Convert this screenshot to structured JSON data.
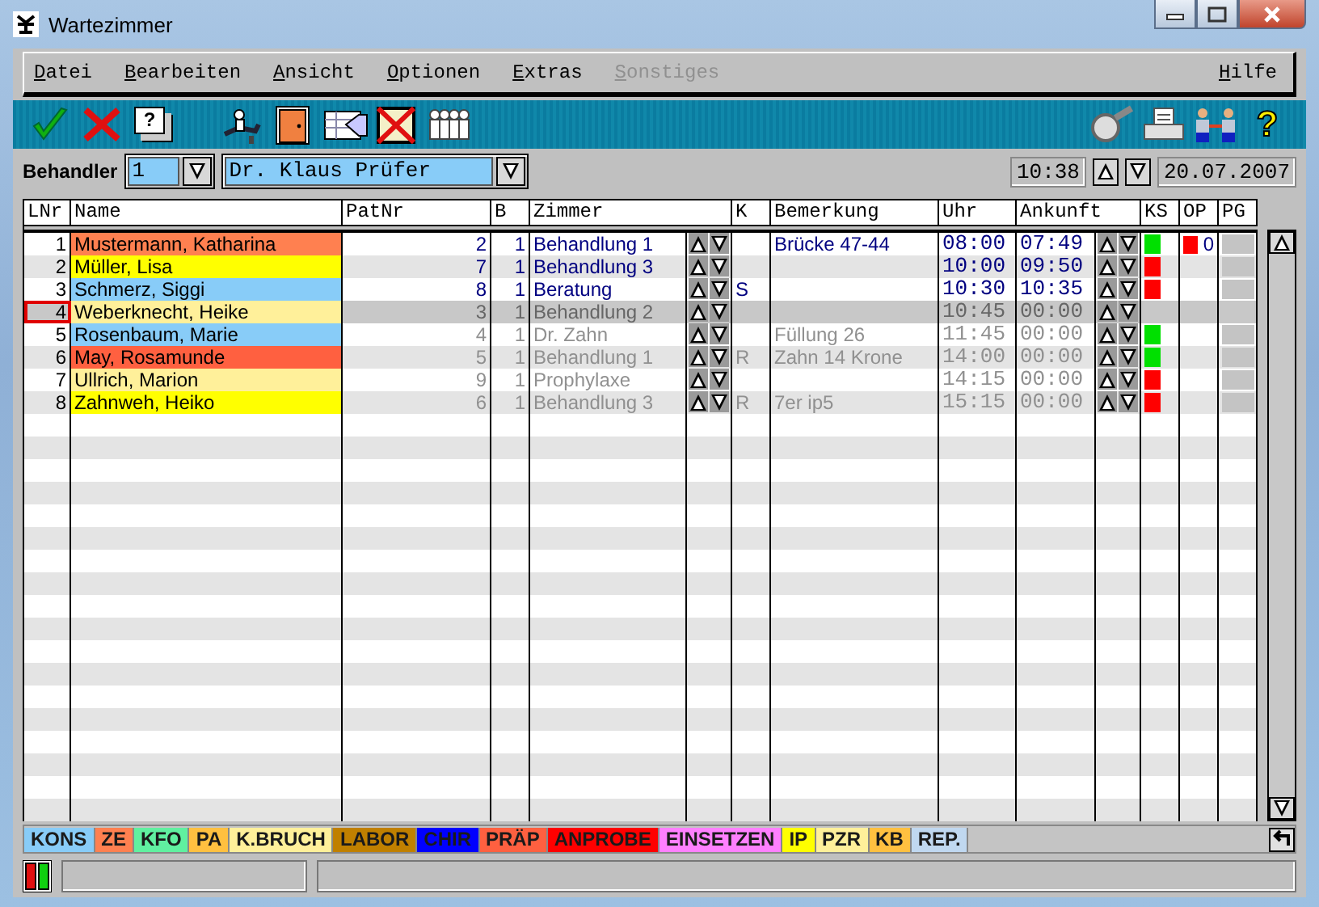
{
  "window": {
    "title": "Wartezimmer"
  },
  "menu": [
    {
      "label": "Datei",
      "disabled": false
    },
    {
      "label": "Bearbeiten",
      "disabled": false
    },
    {
      "label": "Ansicht",
      "disabled": false
    },
    {
      "label": "Optionen",
      "disabled": false
    },
    {
      "label": "Extras",
      "disabled": false
    },
    {
      "label": "Sonstiges",
      "disabled": true
    },
    {
      "label": "Hilfe",
      "disabled": false
    }
  ],
  "toolbar": {
    "left": [
      {
        "kind": "check"
      },
      {
        "kind": "cancel"
      },
      {
        "kind": "help-pages",
        "glyph": "?"
      },
      {
        "kind": "dentist"
      },
      {
        "kind": "door"
      },
      {
        "kind": "card"
      },
      {
        "kind": "crossed"
      },
      {
        "kind": "group"
      }
    ],
    "right": [
      {
        "kind": "magnifier"
      },
      {
        "kind": "printer"
      },
      {
        "kind": "meeting"
      },
      {
        "kind": "help",
        "glyph": "?"
      }
    ]
  },
  "behandler": {
    "label": "Behandler",
    "number": "1",
    "name": "Dr. Klaus Prüfer"
  },
  "clock": {
    "time": "10:38",
    "date": "20.07.2007"
  },
  "table": {
    "columns": [
      "LNr",
      "Name",
      "PatNr",
      "B",
      "Zimmer",
      "K",
      "Bemerkung",
      "Uhr",
      "Ankunft",
      "KS",
      "OP",
      "PG"
    ],
    "rows": [
      {
        "lnr": "1",
        "name": "Mustermann, Katharina",
        "color": "#ff8050",
        "patnr": "2",
        "b": "1",
        "zimmer": "Behandlung 1",
        "bemerkung": "Brücke 47-44",
        "uhr": "08:00",
        "ankunft": "07:49",
        "arrived": true,
        "selected": false,
        "ks": {
          "color": "#00e000"
        },
        "op": {
          "color": "#ff0000",
          "text": "0"
        }
      },
      {
        "lnr": "2",
        "name": "Müller, Lisa",
        "color": "#ffff00",
        "patnr": "7",
        "b": "1",
        "zimmer": "Behandlung 3",
        "uhr": "10:00",
        "ankunft": "09:50",
        "arrived": true,
        "selected": false,
        "ks": {
          "color": "#ff0000"
        }
      },
      {
        "lnr": "3",
        "name": "Schmerz, Siggi",
        "color": "#88ccf8",
        "patnr": "8",
        "b": "1",
        "zimmer": "Beratung",
        "k": "S",
        "uhr": "10:30",
        "ankunft": "10:35",
        "arrived": true,
        "selected": false,
        "ks": {
          "color": "#ff0000"
        }
      },
      {
        "lnr": "4",
        "name": "Weberknecht, Heike",
        "color": "#fff09a",
        "patnr": "3",
        "b": "1",
        "zimmer": "Behandlung 2",
        "uhr": "10:45",
        "ankunft": "00:00",
        "arrived": false,
        "selected": true
      },
      {
        "lnr": "5",
        "name": "Rosenbaum, Marie",
        "color": "#88ccf8",
        "patnr": "4",
        "b": "1",
        "zimmer": "Dr. Zahn",
        "bemerkung": "Füllung 26",
        "uhr": "11:45",
        "ankunft": "00:00",
        "arrived": false,
        "selected": false,
        "ks": {
          "color": "#00e000"
        }
      },
      {
        "lnr": "6",
        "name": "May, Rosamunde",
        "color": "#ff6040",
        "patnr": "5",
        "b": "1",
        "zimmer": "Behandlung 1",
        "k": "R",
        "bemerkung": "Zahn 14 Krone",
        "uhr": "14:00",
        "ankunft": "00:00",
        "arrived": false,
        "selected": false,
        "ks": {
          "color": "#00e000"
        }
      },
      {
        "lnr": "7",
        "name": "Ullrich, Marion",
        "color": "#fff09a",
        "patnr": "9",
        "b": "1",
        "zimmer": "Prophylaxe",
        "uhr": "14:15",
        "ankunft": "00:00",
        "arrived": false,
        "selected": false,
        "ks": {
          "color": "#ff0000"
        }
      },
      {
        "lnr": "8",
        "name": "Zahnweh, Heiko",
        "color": "#ffff00",
        "patnr": "6",
        "b": "1",
        "zimmer": "Behandlung 3",
        "k": "R",
        "bemerkung": "7er ip5",
        "uhr": "15:15",
        "ankunft": "00:00",
        "arrived": false,
        "selected": false,
        "ks": {
          "color": "#ff0000"
        }
      }
    ]
  },
  "legend": [
    {
      "label": "KONS",
      "color": "#88ccf8"
    },
    {
      "label": "ZE",
      "color": "#ff8050"
    },
    {
      "label": "KFO",
      "color": "#60f0a0"
    },
    {
      "label": "PA",
      "color": "#ffc040"
    },
    {
      "label": "K.BRUCH",
      "color": "#fff09a"
    },
    {
      "label": "LABOR",
      "color": "#c08000"
    },
    {
      "label": "CHIR",
      "color": "#0000ff"
    },
    {
      "label": "PRÄP",
      "color": "#ff6040"
    },
    {
      "label": "ANPROBE",
      "color": "#ff0000"
    },
    {
      "label": "EINSETZEN",
      "color": "#ff80ff"
    },
    {
      "label": "IP",
      "color": "#ffff00"
    },
    {
      "label": "PZR",
      "color": "#fff09a"
    },
    {
      "label": "KB",
      "color": "#ffc040"
    },
    {
      "label": "REP.",
      "color": "#c0d8f0"
    }
  ]
}
